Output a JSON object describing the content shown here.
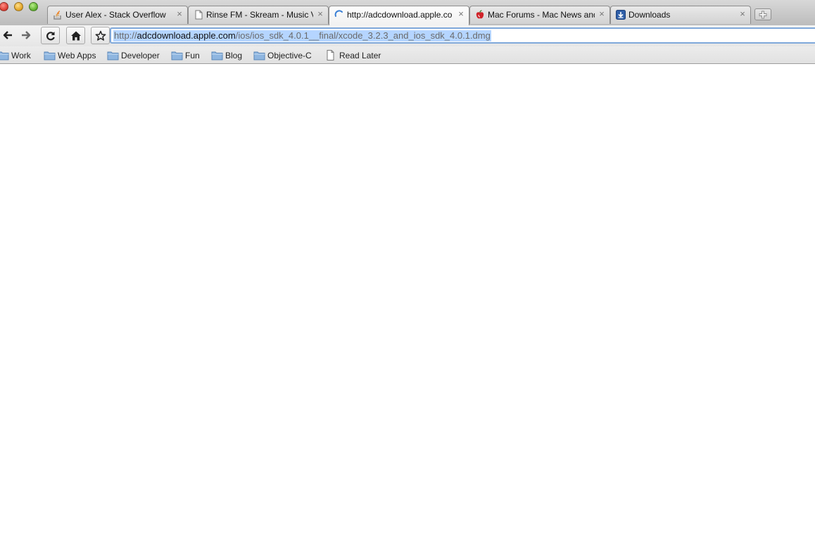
{
  "tabs": [
    {
      "title": "User Alex - Stack Overflow",
      "favicon": "stack-overflow-icon"
    },
    {
      "title": "Rinse FM - Skream - Music V",
      "favicon": "page-icon"
    },
    {
      "title": "http://adcdownload.apple.co",
      "favicon": "loading-spinner-icon",
      "active": true
    },
    {
      "title": "Mac Forums - Mac News and",
      "favicon": "mac-forums-apple-icon"
    },
    {
      "title": "Downloads",
      "favicon": "downloads-icon"
    }
  ],
  "tab_close_glyph": "×",
  "toolbar": {
    "back": "back-arrow-icon",
    "forward": "forward-arrow-icon",
    "reload": "reload-icon",
    "home": "home-icon",
    "bookmark": "star-icon"
  },
  "omnibox": {
    "scheme": "http://",
    "host": "adcdownload.apple.com",
    "path": "/ios/ios_sdk_4.0.1__final/xcode_3.2.3_and_ios_sdk_4.0.1.dmg",
    "selected": true
  },
  "bookmarks": [
    {
      "label": "Work",
      "icon": "folder-icon"
    },
    {
      "label": "Web Apps",
      "icon": "folder-icon"
    },
    {
      "label": "Developer",
      "icon": "folder-icon"
    },
    {
      "label": "Fun",
      "icon": "folder-icon"
    },
    {
      "label": "Blog",
      "icon": "folder-icon"
    },
    {
      "label": "Objective-C",
      "icon": "folder-icon"
    },
    {
      "label": "Read Later",
      "icon": "page-icon"
    }
  ],
  "colors": {
    "selection": "#b5d5ff",
    "focus_ring": "#7fa8da",
    "folder": "#8fb6e0"
  }
}
